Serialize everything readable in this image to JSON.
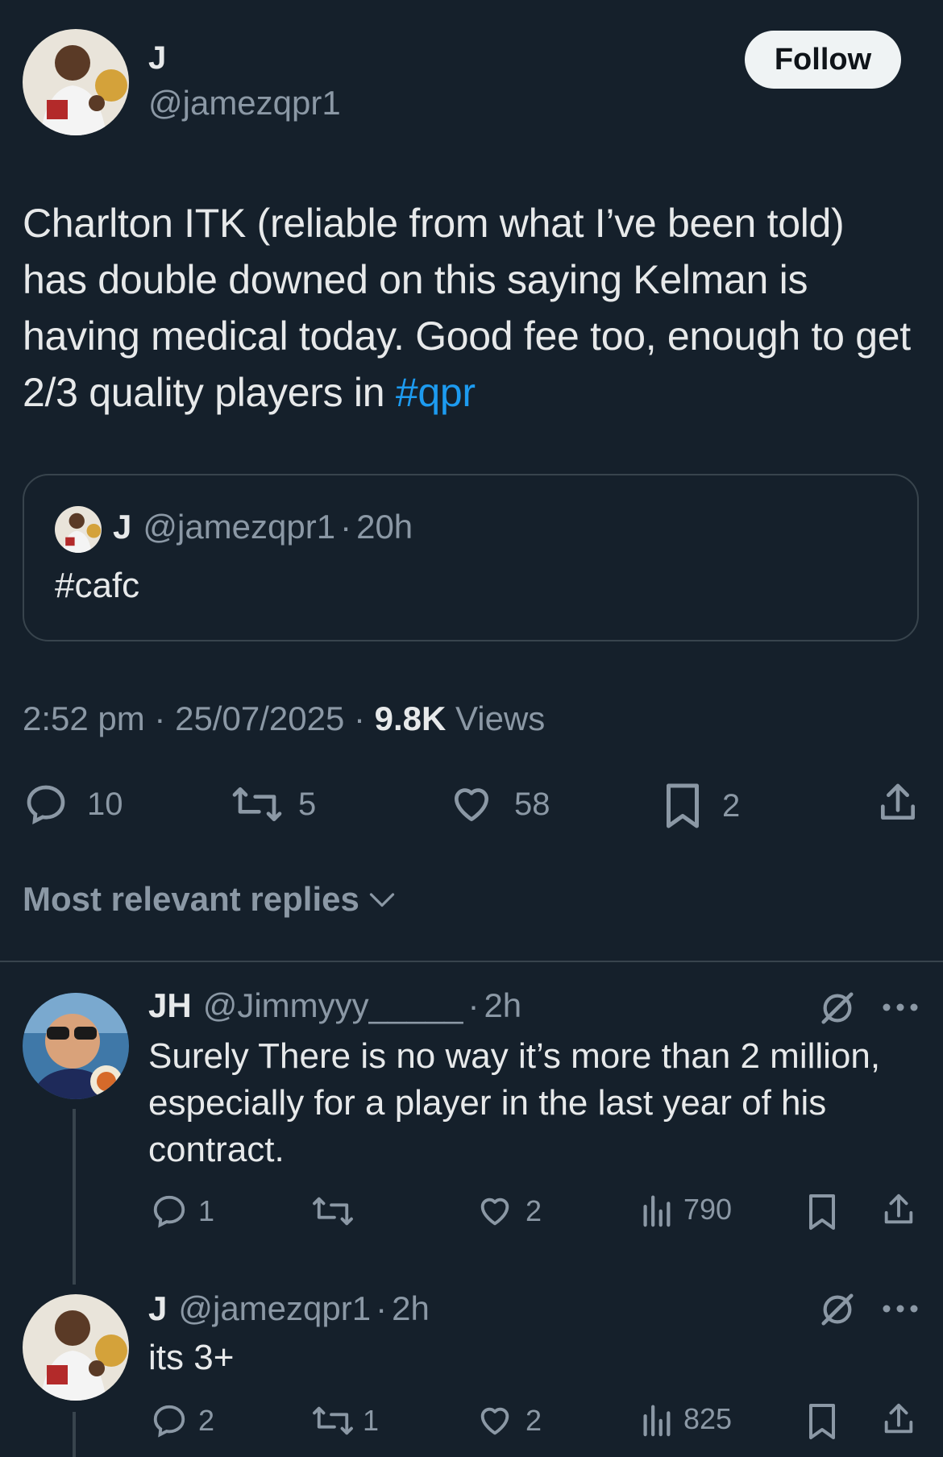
{
  "author": {
    "name": "J",
    "handle": "@jamezqpr1",
    "follow_label": "Follow"
  },
  "tweet": {
    "text_main": "Charlton ITK (reliable from what I’ve been told) has double downed on this saying Kelman is having medical today. Good fee too, enough to get 2/3 quality players in ",
    "hashtag": "#qpr"
  },
  "quoted": {
    "name": "J",
    "handle": "@jamezqpr1",
    "time": "20h",
    "text": "#cafc"
  },
  "meta": {
    "time": "2:52 pm",
    "date": "25/07/2025",
    "views_count": "9.8K",
    "views_label": "Views"
  },
  "stats": {
    "replies": "10",
    "reposts": "5",
    "likes": "58",
    "bookmarks": "2"
  },
  "replies_header": "Most relevant replies",
  "replies": [
    {
      "name": "JH",
      "handle": "@Jimmyyy_____",
      "time": "2h",
      "text": "Surely There is no way it’s more than 2 million, especially for a player in the last year of his contract.",
      "replies": "1",
      "reposts": "",
      "likes": "2",
      "views": "790"
    },
    {
      "name": "J",
      "handle": "@jamezqpr1",
      "time": "2h",
      "text": "its 3+",
      "replies": "2",
      "reposts": "1",
      "likes": "2",
      "views": "825"
    }
  ],
  "icons": {
    "reply": "reply-icon",
    "repost": "repost-icon",
    "like": "heart-icon",
    "bookmark": "bookmark-icon",
    "share": "share-icon",
    "views": "views-icon",
    "grok": "grok-icon",
    "more": "more-icon"
  },
  "colors": {
    "background": "#15202b",
    "accent": "#1d9bf0",
    "muted": "#8b98a5",
    "text": "#e7e9ea"
  }
}
